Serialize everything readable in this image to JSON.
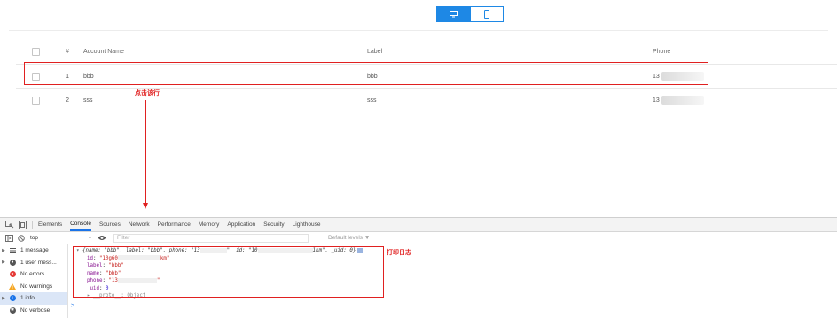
{
  "table": {
    "headers": {
      "index": "#",
      "account_name": "Account Name",
      "label": "Label",
      "phone": "Phone"
    },
    "rows": [
      {
        "index": "1",
        "account_name": "bbb",
        "label": "bbb",
        "phone": "13"
      },
      {
        "index": "2",
        "account_name": "sss",
        "label": "sss",
        "phone": "13"
      }
    ]
  },
  "annotations": {
    "click_row": "点击该行",
    "print_log": "打印日志"
  },
  "devtools": {
    "tabs": [
      "Elements",
      "Console",
      "Sources",
      "Network",
      "Performance",
      "Memory",
      "Application",
      "Security",
      "Lighthouse"
    ],
    "active_tab": "Console",
    "context": "top",
    "filter_placeholder": "Filter",
    "levels": "Default levels ▼",
    "sidebar": [
      "1 message",
      "1 user mess...",
      "No errors",
      "No warnings",
      "1 info",
      "No verbose"
    ],
    "log": {
      "p1": "{name: \"bbb\", label: \"bbb\", phone: \"13",
      "p2": "\", id: \"10",
      "p3": "1km\", _uid: 0}",
      "id_key": "id: ",
      "id_val_a": "\"10g60",
      "id_val_b": "km\"",
      "label_line": "\"bbb\"",
      "name_line": "\"bbb\"",
      "phone_val_a": "\"13",
      "phone_val_b": "\"",
      "uid_val": "0",
      "proto": "▸ __proto__: Object"
    },
    "prompt": ">"
  }
}
